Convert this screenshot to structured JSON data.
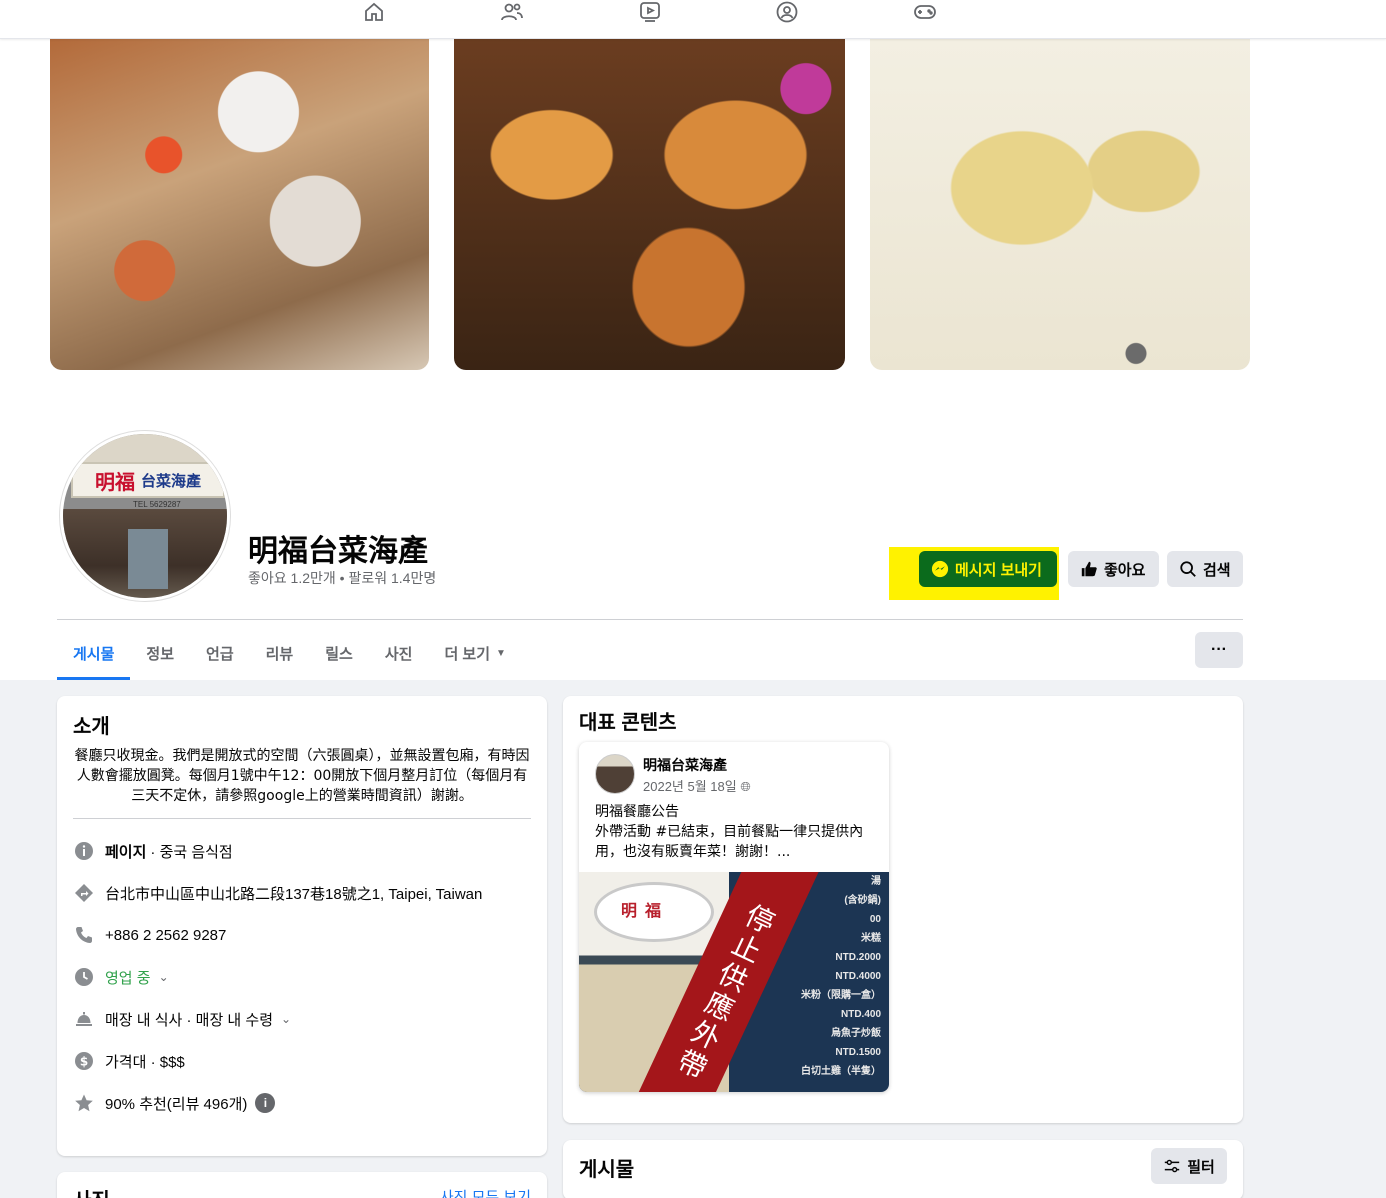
{
  "topnav": {
    "icons": [
      "home-icon",
      "friends-icon",
      "video-icon",
      "groups-icon",
      "gaming-icon"
    ]
  },
  "page": {
    "title": "明福台菜海產",
    "stats_likes": "좋아요 1.2만개",
    "stats_sep": " • ",
    "stats_followers": "팔로워 1.4만명",
    "avatar_sign_red": "明福",
    "avatar_sign_blue": "台菜海產",
    "avatar_tel": "TEL 5629287"
  },
  "actions": {
    "message": "메시지 보내기",
    "like": "좋아요",
    "search": "검색",
    "highlight_color": "#fff200"
  },
  "tabs": {
    "items": [
      "게시물",
      "정보",
      "언급",
      "리뷰",
      "릴스",
      "사진",
      "더 보기"
    ],
    "more_options": "···"
  },
  "intro": {
    "title": "소개",
    "bio": "餐廳只收現金。我們是開放式的空間（六張圓桌），並無設置包廂，有時因人數會擺放圓凳。每個月1號中午12：00開放下個月整月訂位（每個月有三天不定休，請參照google上的營業時間資訊）謝謝。",
    "category_label": "페이지",
    "category_value": " · 중국 음식점",
    "address": "台北市中山區中山北路二段137巷18號之1, Taipei, Taiwan",
    "phone": "+886 2 2562 9287",
    "hours": "영업 중",
    "service": "매장 내 식사 · 매장 내 수령",
    "price": "가격대 · $$$",
    "rating": "90% 추천(리뷰 496개)"
  },
  "photos": {
    "title": "사진",
    "see_all": "사진 모두 보기"
  },
  "featured": {
    "title": "대표 콘텐츠",
    "post": {
      "author": "明福台菜海產",
      "date": "2022년 5월 18일",
      "text_line1": "明福餐廳公告",
      "text_line2": "外帶活動 #已結束，目前餐點一律只提供內用，也沒有販賣年菜！謝謝！...",
      "image_banner": "停止供應外帶",
      "image_bowl": "明福",
      "image_menu": [
        "湯",
        "(含砂鍋)",
        "00",
        "米糕",
        "NTD.2000",
        "NTD.4000",
        "米粉（限購一盒）",
        "NTD.400",
        "烏魚子炒飯",
        "NTD.1500",
        "白切土雞（半隻）"
      ]
    }
  },
  "posts": {
    "title": "게시물",
    "filter": "필터"
  }
}
